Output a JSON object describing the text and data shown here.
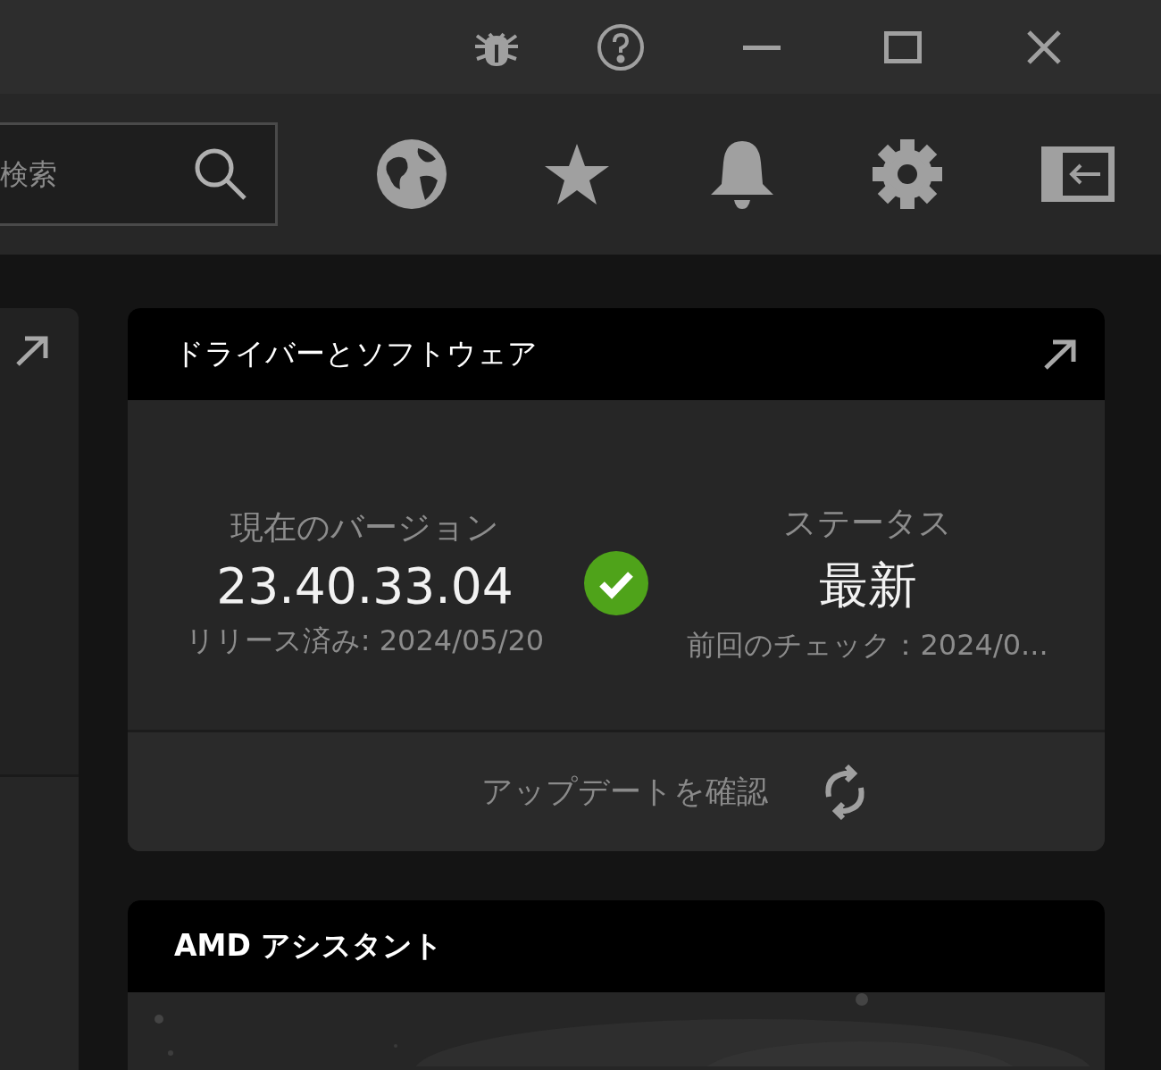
{
  "title_bar": {
    "buttons": [
      {
        "kind": "bug"
      },
      {
        "kind": "help"
      },
      {
        "kind": "minimize"
      },
      {
        "kind": "maximize"
      },
      {
        "kind": "close"
      }
    ]
  },
  "toolbar": {
    "search": {
      "placeholder": "検索"
    },
    "buttons": [
      {
        "kind": "globe"
      },
      {
        "kind": "star"
      },
      {
        "kind": "bell"
      },
      {
        "kind": "gear"
      },
      {
        "kind": "sidebar"
      }
    ]
  },
  "left_panel": {
    "kind": "card"
  },
  "driver_card": {
    "title": "ドライバーとソフトウェア",
    "current_version": {
      "label": "現在のバージョン",
      "value": "23.40.33.04",
      "released": "リリース済み: 2024/05/20"
    },
    "up_to_date": true,
    "status": {
      "label": "ステータス",
      "value": "最新",
      "last_check": "前回のチェック：2024/0..."
    },
    "check_button": "アップデートを確認"
  },
  "assistant_card": {
    "title": "AMD アシスタント"
  }
}
